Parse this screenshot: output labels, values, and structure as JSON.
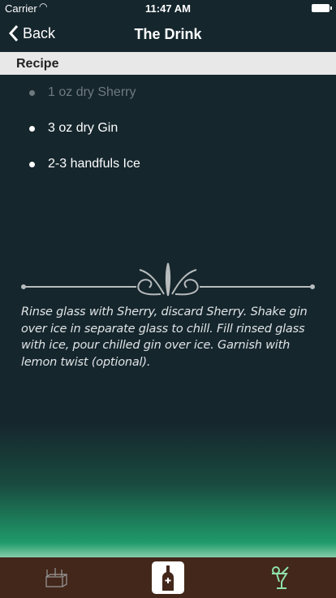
{
  "status": {
    "carrier": "Carrier",
    "time": "11:47 AM"
  },
  "nav": {
    "back_label": "Back",
    "title": "The Drink"
  },
  "section": {
    "title": "Recipe"
  },
  "ingredients": [
    "1 oz dry Sherry",
    "3 oz dry Gin",
    "2-3 handfuls Ice"
  ],
  "instructions": "Rinse glass with Sherry, discard Sherry. Shake gin over ice in separate glass to chill. Fill rinsed glass with ice, pour chilled gin over ice. Garnish with lemon twist (optional).",
  "tabs": [
    {
      "icon": "bottle-crate-icon",
      "selected": false
    },
    {
      "icon": "bottle-icon",
      "selected": true
    },
    {
      "icon": "cocktail-icon",
      "selected": false
    }
  ],
  "colors": {
    "background": "#15262d",
    "tabbar": "#43271b",
    "accent_green": "#8fe0a8"
  }
}
